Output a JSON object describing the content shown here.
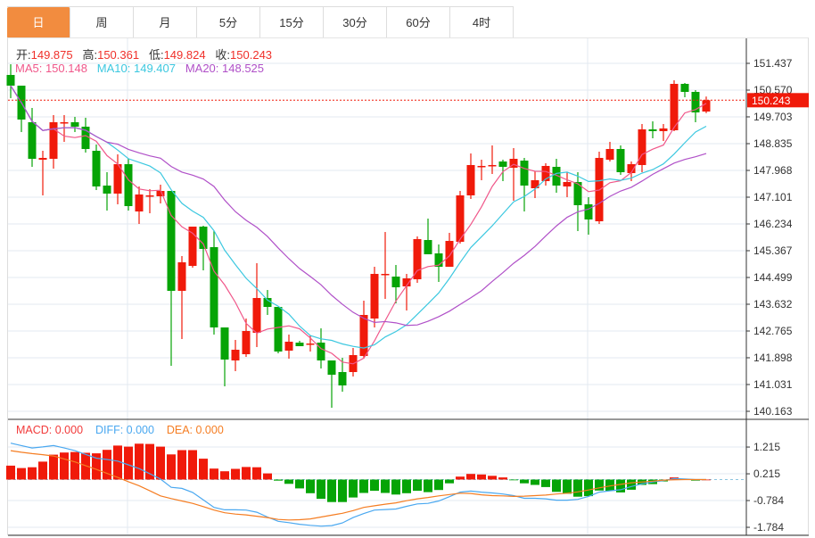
{
  "tabs": [
    {
      "label": "日",
      "active": true
    },
    {
      "label": "周"
    },
    {
      "label": "月"
    },
    {
      "label": "5分"
    },
    {
      "label": "15分"
    },
    {
      "label": "30分"
    },
    {
      "label": "60分"
    },
    {
      "label": "4时"
    }
  ],
  "ohlc": {
    "open_label": "开:",
    "open": "149.875",
    "high_label": "高:",
    "high": "150.361",
    "low_label": "低:",
    "low": "149.824",
    "close_label": "收:",
    "close": "150.243"
  },
  "ma": {
    "ma5_label": "MA5: 150.148",
    "ma10_label": "MA10: 149.407",
    "ma20_label": "MA20: 148.525"
  },
  "macd_legend": {
    "macd": "MACD: 0.000",
    "diff": "DIFF: 0.000",
    "dea": "DEA: 0.000"
  },
  "colors": {
    "up": "#f01a0a",
    "down": "#06a406",
    "ma5": "#f0578a",
    "ma10": "#3cc8e0",
    "ma20": "#b050c8",
    "diff": "#4aa8f0",
    "dea": "#f57d22",
    "accent": "#f28c3f"
  },
  "chart_data": [
    {
      "type": "candlestick",
      "title": "",
      "ylim": [
        140.163,
        151.437
      ],
      "yticks": [
        "151.437",
        "150.570",
        "149.703",
        "148.835",
        "147.968",
        "147.101",
        "146.234",
        "145.367",
        "144.499",
        "143.632",
        "142.765",
        "141.898",
        "141.031",
        "140.163"
      ],
      "last_price": "150.243",
      "grid": true,
      "moving_averages": [
        5,
        10,
        20
      ],
      "candles": [
        [
          151.061,
          151.408,
          150.31,
          150.714
        ],
        [
          150.714,
          150.714,
          149.211,
          149.616
        ],
        [
          149.529,
          149.992,
          148.084,
          148.344
        ],
        [
          148.315,
          148.604,
          147.159,
          148.373
        ],
        [
          148.344,
          149.76,
          148.026,
          149.529
        ],
        [
          149.5,
          149.76,
          148.893,
          149.529
        ],
        [
          149.529,
          149.703,
          149.211,
          149.385
        ],
        [
          149.385,
          149.674,
          148.546,
          148.662
        ],
        [
          148.604,
          148.806,
          147.332,
          147.448
        ],
        [
          147.477,
          147.91,
          146.667,
          147.217
        ],
        [
          147.217,
          148.488,
          146.87,
          148.17
        ],
        [
          148.17,
          148.344,
          146.667,
          146.812
        ],
        [
          146.638,
          147.448,
          146.234,
          147.188
        ],
        [
          147.13,
          147.361,
          146.58,
          147.159
        ],
        [
          147.13,
          147.506,
          146.899,
          147.303
        ],
        [
          147.303,
          147.303,
          141.637,
          144.066
        ],
        [
          144.066,
          145.193,
          142.505,
          144.991
        ],
        [
          144.875,
          146.147,
          144.817,
          146.147
        ],
        [
          146.147,
          146.176,
          144.73,
          145.424
        ],
        [
          145.482,
          146.002,
          142.649,
          142.88
        ],
        [
          142.88,
          142.88,
          140.972,
          141.84
        ],
        [
          141.811,
          142.476,
          141.464,
          142.158
        ],
        [
          142.013,
          143.169,
          141.926,
          142.765
        ],
        [
          142.707,
          144.962,
          142.244,
          143.834
        ],
        [
          143.834,
          144.094,
          143.285,
          143.545
        ],
        [
          143.545,
          143.545,
          142.042,
          142.1
        ],
        [
          142.129,
          142.649,
          141.869,
          142.418
        ],
        [
          142.389,
          142.447,
          142.273,
          142.273
        ],
        [
          142.36,
          142.62,
          142.1,
          142.36
        ],
        [
          142.389,
          142.851,
          141.551,
          141.811
        ],
        [
          141.811,
          141.811,
          140.279,
          141.348
        ],
        [
          141.435,
          141.897,
          140.799,
          141.001
        ],
        [
          141.435,
          142.215,
          141.29,
          141.984
        ],
        [
          141.955,
          143.748,
          141.869,
          143.285
        ],
        [
          143.169,
          144.846,
          142.88,
          144.615
        ],
        [
          144.615,
          145.973,
          143.805,
          144.615
        ],
        [
          144.528,
          144.904,
          143.661,
          144.181
        ],
        [
          144.21,
          144.615,
          143.43,
          144.47
        ],
        [
          144.441,
          145.829,
          144.326,
          145.742
        ],
        [
          145.713,
          146.407,
          145.251,
          145.251
        ],
        [
          145.28,
          145.569,
          144.355,
          144.846
        ],
        [
          144.846,
          145.945,
          144.846,
          145.684
        ],
        [
          145.655,
          147.303,
          145.598,
          147.159
        ],
        [
          147.159,
          148.517,
          147.043,
          148.142
        ],
        [
          148.113,
          148.315,
          147.65,
          148.113
        ],
        [
          148.142,
          148.778,
          147.852,
          148.142
        ],
        [
          148.257,
          148.315,
          147.621,
          148.084
        ],
        [
          148.055,
          148.691,
          146.985,
          148.344
        ],
        [
          148.286,
          148.373,
          146.638,
          147.477
        ],
        [
          147.39,
          147.939,
          147.072,
          147.65
        ],
        [
          147.621,
          148.199,
          147.477,
          148.113
        ],
        [
          148.084,
          148.344,
          147.245,
          147.477
        ],
        [
          147.448,
          147.91,
          147.101,
          147.592
        ],
        [
          147.592,
          147.91,
          146.002,
          146.841
        ],
        [
          146.87,
          147.101,
          145.887,
          146.378
        ],
        [
          146.32,
          148.575,
          146.234,
          148.373
        ],
        [
          148.315,
          148.893,
          148.257,
          148.662
        ],
        [
          148.662,
          148.778,
          147.824,
          147.91
        ],
        [
          147.881,
          148.257,
          147.621,
          148.17
        ],
        [
          148.142,
          149.471,
          147.91,
          149.298
        ],
        [
          149.298,
          149.558,
          149.009,
          149.24
        ],
        [
          149.24,
          149.471,
          148.922,
          149.327
        ],
        [
          149.269,
          150.888,
          149.24,
          150.772
        ],
        [
          150.772,
          150.801,
          150.339,
          150.512
        ],
        [
          150.512,
          150.57,
          149.529,
          149.847
        ],
        [
          149.875,
          150.361,
          149.824,
          150.243
        ]
      ]
    },
    {
      "type": "macd",
      "ylim": [
        -1.784,
        1.215
      ],
      "yticks": [
        "1.215",
        "0.215",
        "-0.784",
        "-1.784"
      ],
      "histogram": [
        0.52,
        0.43,
        0.46,
        0.67,
        0.93,
        1.01,
        1.03,
        1.0,
        0.98,
        1.11,
        1.27,
        1.23,
        1.34,
        1.33,
        1.23,
        0.94,
        1.1,
        1.1,
        0.78,
        0.41,
        0.31,
        0.4,
        0.47,
        0.46,
        0.23,
        -0.04,
        -0.16,
        -0.33,
        -0.51,
        -0.72,
        -0.84,
        -0.84,
        -0.67,
        -0.5,
        -0.42,
        -0.5,
        -0.56,
        -0.51,
        -0.42,
        -0.47,
        -0.39,
        -0.14,
        0.11,
        0.21,
        0.19,
        0.14,
        0.08,
        -0.01,
        -0.14,
        -0.2,
        -0.28,
        -0.46,
        -0.53,
        -0.64,
        -0.62,
        -0.41,
        -0.42,
        -0.48,
        -0.38,
        -0.2,
        -0.17,
        -0.07,
        0.08,
        0.01,
        -0.04,
        0.0
      ],
      "diff": [
        1.36,
        1.27,
        1.18,
        1.22,
        1.27,
        1.18,
        1.08,
        0.94,
        0.8,
        0.75,
        0.69,
        0.55,
        0.41,
        0.22,
        0.02,
        -0.29,
        -0.33,
        -0.48,
        -0.76,
        -1.04,
        -1.13,
        -1.13,
        -1.14,
        -1.22,
        -1.4,
        -1.56,
        -1.61,
        -1.67,
        -1.71,
        -1.74,
        -1.72,
        -1.62,
        -1.42,
        -1.27,
        -1.14,
        -1.12,
        -1.1,
        -1.0,
        -0.91,
        -0.89,
        -0.8,
        -0.64,
        -0.47,
        -0.43,
        -0.47,
        -0.5,
        -0.54,
        -0.6,
        -0.7,
        -0.7,
        -0.72,
        -0.77,
        -0.77,
        -0.74,
        -0.63,
        -0.47,
        -0.42,
        -0.38,
        -0.26,
        -0.16,
        -0.09,
        -0.04,
        0.04,
        0.02,
        0.0,
        0.0
      ],
      "dea": [
        1.08,
        1.02,
        0.97,
        0.93,
        0.88,
        0.77,
        0.66,
        0.52,
        0.38,
        0.23,
        0.08,
        -0.08,
        -0.23,
        -0.42,
        -0.61,
        -0.71,
        -0.8,
        -0.89,
        -1.01,
        -1.14,
        -1.24,
        -1.29,
        -1.32,
        -1.37,
        -1.42,
        -1.49,
        -1.51,
        -1.5,
        -1.47,
        -1.4,
        -1.33,
        -1.26,
        -1.16,
        -1.04,
        -0.98,
        -0.92,
        -0.87,
        -0.79,
        -0.72,
        -0.67,
        -0.61,
        -0.56,
        -0.51,
        -0.52,
        -0.57,
        -0.6,
        -0.61,
        -0.63,
        -0.62,
        -0.6,
        -0.58,
        -0.54,
        -0.51,
        -0.46,
        -0.39,
        -0.31,
        -0.24,
        -0.18,
        -0.12,
        -0.09,
        -0.06,
        -0.02,
        -0.01,
        0.0,
        0.0,
        0.0
      ]
    }
  ]
}
